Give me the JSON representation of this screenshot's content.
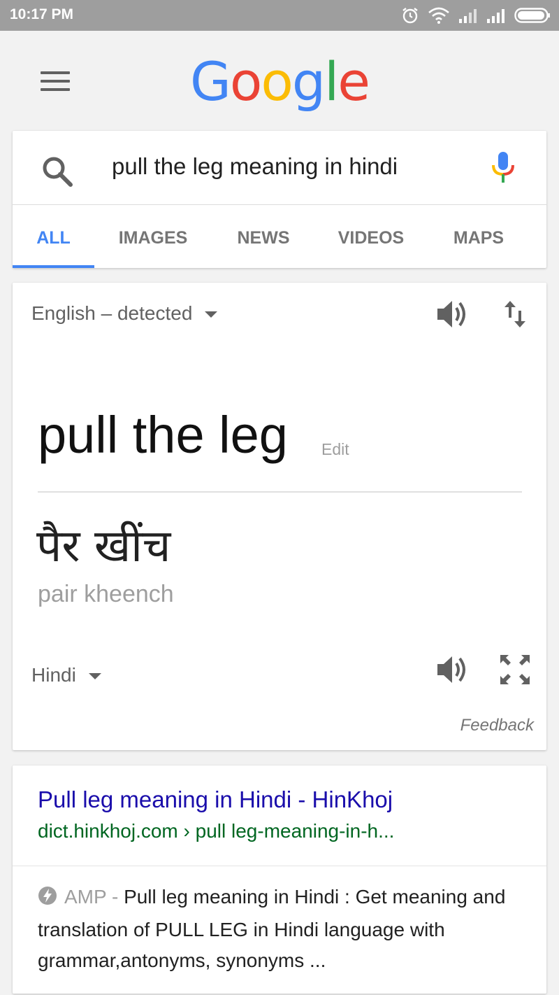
{
  "status_bar": {
    "time": "10:17 PM",
    "icons": [
      "alarm-icon",
      "wifi-icon",
      "signal-icon",
      "signal-icon",
      "battery-icon"
    ]
  },
  "header": {
    "menu_icon": "hamburger-menu-icon",
    "logo_letters": [
      {
        "char": "G",
        "color": "#4285f4"
      },
      {
        "char": "o",
        "color": "#ea4335"
      },
      {
        "char": "o",
        "color": "#fbbc05"
      },
      {
        "char": "g",
        "color": "#4285f4"
      },
      {
        "char": "l",
        "color": "#34a853"
      },
      {
        "char": "e",
        "color": "#ea4335"
      }
    ]
  },
  "search": {
    "query": "pull the leg meaning in hindi",
    "search_icon": "search-icon",
    "mic_icon": "microphone-icon"
  },
  "tabs": [
    {
      "label": "ALL",
      "active": true
    },
    {
      "label": "IMAGES",
      "active": false
    },
    {
      "label": "NEWS",
      "active": false
    },
    {
      "label": "VIDEOS",
      "active": false
    },
    {
      "label": "MAPS",
      "active": false
    }
  ],
  "translate": {
    "source_language": "English – detected",
    "source_text": "pull the leg",
    "edit_label": "Edit",
    "target_text": "पैर खींच",
    "transliteration": "pair kheench",
    "target_language": "Hindi",
    "feedback_label": "Feedback",
    "icons": [
      "speaker-icon",
      "swap-languages-icon",
      "speaker-icon",
      "fullscreen-icon"
    ]
  },
  "result": {
    "title": "Pull leg meaning in Hindi - HinKhoj",
    "url": "dict.hinkhoj.com › pull leg-meaning-in-h...",
    "amp_label": "AMP -",
    "snippet": "Pull leg meaning in Hindi : Get meaning and translation of PULL LEG in Hindi language with grammar,antonyms, synonyms ..."
  },
  "colors": {
    "accent_blue": "#4285f4",
    "link_blue": "#1a0dab",
    "url_green": "#006621"
  }
}
